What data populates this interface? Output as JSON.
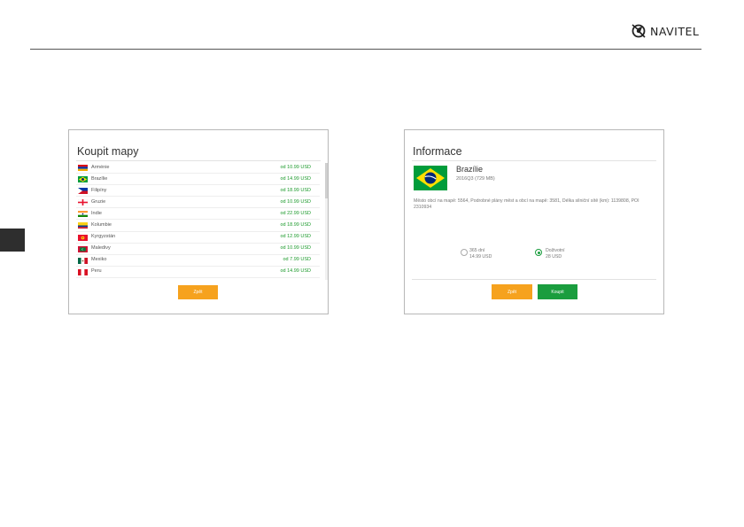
{
  "brand": {
    "name": "NAVITEL"
  },
  "buy_maps": {
    "title": "Koupit mapy",
    "items": [
      {
        "country": "Arménie",
        "price": "od 10.99 USD",
        "flag": "armenia"
      },
      {
        "country": "Brazílie",
        "price": "od 14.99 USD",
        "flag": "brazil"
      },
      {
        "country": "Filipíny",
        "price": "od 18.99 USD",
        "flag": "philippines"
      },
      {
        "country": "Gruzie",
        "price": "od 10.99 USD",
        "flag": "georgia"
      },
      {
        "country": "Indie",
        "price": "od 22.99 USD",
        "flag": "india"
      },
      {
        "country": "Kolumbie",
        "price": "od 18.99 USD",
        "flag": "colombia"
      },
      {
        "country": "Kyrgyzstán",
        "price": "od 12.99 USD",
        "flag": "kyrgyzstan"
      },
      {
        "country": "Maledivy",
        "price": "od 10.99 USD",
        "flag": "maldives"
      },
      {
        "country": "Mexiko",
        "price": "od 7.99 USD",
        "flag": "mexico"
      },
      {
        "country": "Peru",
        "price": "od 14.99 USD",
        "flag": "peru"
      }
    ],
    "back_label": "Zpět"
  },
  "info": {
    "title": "Informace",
    "map_name": "Brazílie",
    "map_size": "2016Q3 (729 MB)",
    "description": "Město obcí na mapě: 5564, Podrobné plány měst a obcí na mapě: 3581, Délka silniční sítě (km): 1139808, POI 2310934",
    "options": [
      {
        "line1": "365 dní",
        "line2": "14.99 USD",
        "selected": false
      },
      {
        "line1": "Doživotní",
        "line2": "28 USD",
        "selected": true
      }
    ],
    "back_label": "Zpět",
    "buy_label": "Koupit"
  },
  "colors": {
    "accent_green": "#1a9d3e",
    "accent_orange": "#f6a21e",
    "price_green": "#1c9a2c"
  }
}
